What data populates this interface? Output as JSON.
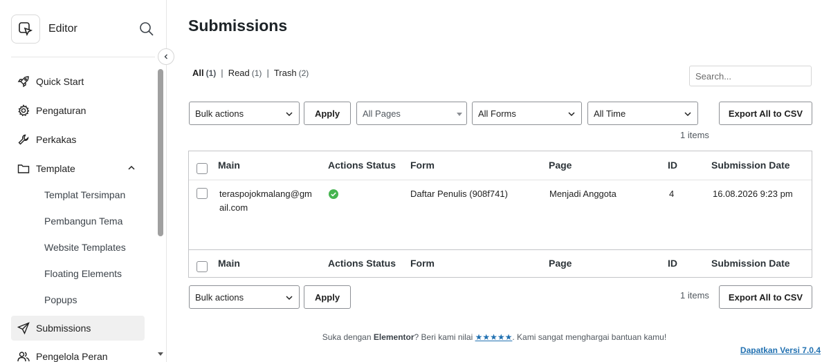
{
  "sidebar": {
    "title": "Editor",
    "items": [
      {
        "label": "Quick Start",
        "icon": "rocket-icon"
      },
      {
        "label": "Pengaturan",
        "icon": "gear-icon"
      },
      {
        "label": "Perkakas",
        "icon": "wrench-icon"
      },
      {
        "label": "Template",
        "icon": "folder-icon"
      },
      {
        "label": "Submissions",
        "icon": "send-icon"
      },
      {
        "label": "Pengelola Peran",
        "icon": "users-icon"
      }
    ],
    "template_subitems": [
      "Templat Tersimpan",
      "Pembangun Tema",
      "Website Templates",
      "Floating Elements",
      "Popups"
    ]
  },
  "page": {
    "title": "Submissions",
    "filters": [
      {
        "label": "All",
        "count": "(1)"
      },
      {
        "label": "Read",
        "count": "(1)"
      },
      {
        "label": "Trash",
        "count": "(2)"
      }
    ],
    "search_placeholder": "Search...",
    "bulk_actions": "Bulk actions",
    "apply": "Apply",
    "all_pages": "All Pages",
    "all_forms": "All Forms",
    "all_time": "All Time",
    "export": "Export All to CSV",
    "items_count": "1 items"
  },
  "table": {
    "columns": [
      "Main",
      "Actions Status",
      "Form",
      "Page",
      "ID",
      "Submission Date"
    ],
    "rows": [
      {
        "main_line1": "teraspojokmalang@gm",
        "main_line2": "ail.com",
        "status": "success",
        "form": "Daftar Penulis (908f741)",
        "page": "Menjadi Anggota",
        "id": "4",
        "date": "16.08.2026 9:23 pm"
      }
    ]
  },
  "footer": {
    "text_before": "Suka dengan ",
    "brand": "Elementor",
    "text_mid": "? Beri kami nilai ",
    "stars": "★★★★★",
    "text_after": ". Kami sangat menghargai bantuan kamu!",
    "version": "Dapatkan Versi 7.0.4"
  },
  "colors": {
    "accent": "#2271b1",
    "success": "#46b450",
    "active_bg": "#f0f0f0"
  }
}
